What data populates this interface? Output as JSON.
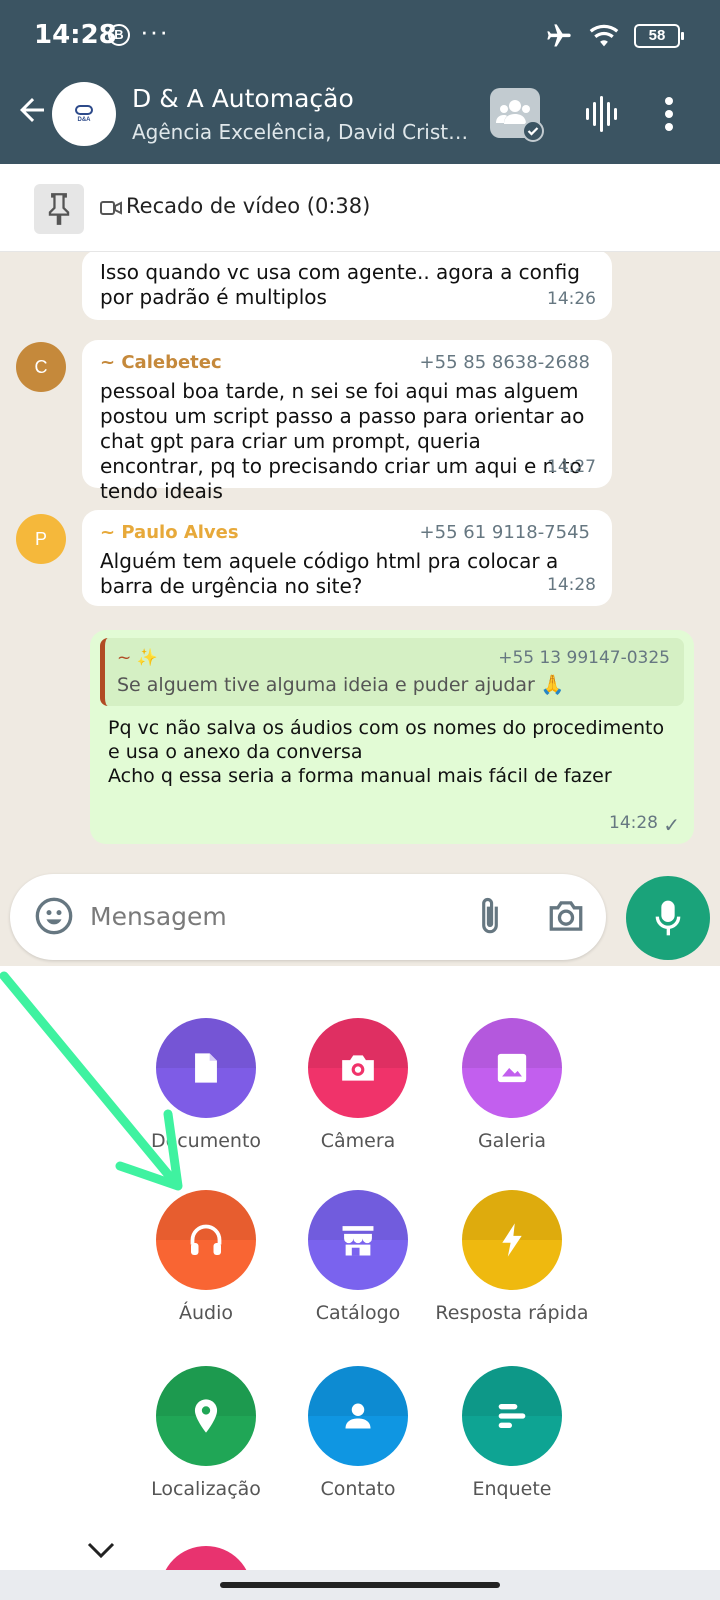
{
  "status_bar": {
    "time": "14:28",
    "b_icon": "B",
    "dots": "···",
    "battery": "58"
  },
  "header": {
    "title": "D & A Automação",
    "subtitle": "Agência Excelência, David Crist…",
    "avatar_logo_text": "D&A"
  },
  "pinned": {
    "label": "Recado de vídeo  (0:38)"
  },
  "messages": [
    {
      "text": "Isso quando vc usa com agente.. agora a config por padrão é multiplos",
      "time": "14:26"
    },
    {
      "avatar_letter": "C",
      "avatar_color": "#c5893b",
      "sender": "~ Calebetec",
      "sender_color": "#c5893b",
      "phone": "+55 85 8638-2688",
      "text": "pessoal boa tarde, n sei se foi aqui mas alguem postou um script passo a passo para orientar ao chat gpt para criar um prompt, queria encontrar, pq to precisando criar um aqui e n to tendo ideais",
      "time": "14:27"
    },
    {
      "avatar_letter": "P",
      "avatar_color": "#f5b83b",
      "sender": "~ Paulo Alves",
      "sender_color": "#e7a93a",
      "phone": "+55 61 9118-7545",
      "text": "Alguém tem aquele código html pra colocar a barra de urgência no site?",
      "time": "14:28"
    },
    {
      "quote_sender": "~ ✨",
      "quote_phone": "+55 13 99147-0325",
      "quote_text": "Se alguem tive alguma ideia e puder ajudar 🙏",
      "text_lines": [
        "Pq vc não salva os áudios com os nomes do procedimento",
        "e usa o anexo da conversa",
        "Acho q essa seria a forma manual mais fácil de fazer"
      ],
      "time": "14:28",
      "check": "✓"
    }
  ],
  "composer": {
    "placeholder": "Mensagem"
  },
  "attachments": [
    {
      "label": "Documento",
      "color": "#7e5ce6",
      "icon": "document-icon"
    },
    {
      "label": "Câmera",
      "color": "#f0336a",
      "icon": "camera-icon"
    },
    {
      "label": "Galeria",
      "color": "#c25fee",
      "icon": "gallery-icon"
    },
    {
      "label": "Áudio",
      "color": "#f96533",
      "icon": "headphones-icon"
    },
    {
      "label": "Catálogo",
      "color": "#7a63ee",
      "icon": "store-icon"
    },
    {
      "label": "Resposta rápida",
      "color": "#efb90f",
      "icon": "lightning-icon"
    },
    {
      "label": "Localização",
      "color": "#20a656",
      "icon": "location-pin-icon"
    },
    {
      "label": "Contato",
      "color": "#0f96e2",
      "icon": "person-icon"
    },
    {
      "label": "Enquete",
      "color": "#0ea493",
      "icon": "poll-icon"
    }
  ],
  "colors": {
    "header_bg": "#3b5462",
    "chat_bg": "#efeae2",
    "mic_button": "#1aa37a",
    "annotation_arrow": "#3ff2a0"
  }
}
